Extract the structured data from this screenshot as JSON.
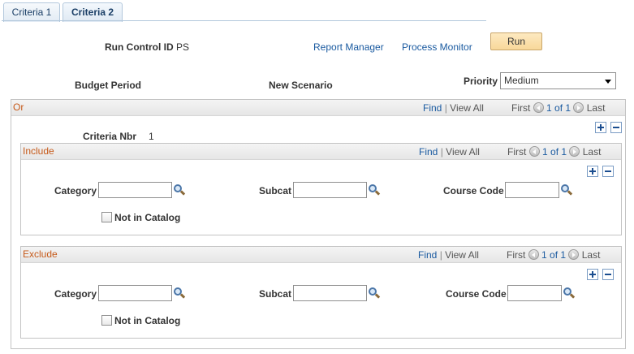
{
  "tabs": [
    {
      "label": "Criteria 1",
      "active": false
    },
    {
      "label": "Criteria 2",
      "active": true
    }
  ],
  "header": {
    "run_control_label": "Run Control ID",
    "run_control_value": "PS",
    "report_manager": "Report Manager",
    "process_monitor": "Process Monitor",
    "run_button": "Run"
  },
  "params": {
    "budget_period_label": "Budget Period",
    "new_scenario_label": "New Scenario",
    "priority_label": "Priority",
    "priority_value": "Medium"
  },
  "or_section": {
    "title": "Or",
    "find": "Find",
    "sep": "|",
    "view_all": "View All",
    "first": "First",
    "count": "1 of 1",
    "last": "Last",
    "criteria_nbr_label": "Criteria Nbr",
    "criteria_nbr_value": "1"
  },
  "include_section": {
    "title": "Include",
    "find": "Find",
    "sep": "|",
    "view_all": "View All",
    "first": "First",
    "count": "1 of 1",
    "last": "Last",
    "category_label": "Category",
    "subcat_label": "Subcat",
    "course_code_label": "Course Code",
    "not_in_catalog_label": "Not in Catalog",
    "category_value": "",
    "subcat_value": "",
    "course_code_value": ""
  },
  "exclude_section": {
    "title": "Exclude",
    "find": "Find",
    "sep": "|",
    "view_all": "View All",
    "first": "First",
    "count": "1 of 1",
    "last": "Last",
    "category_label": "Category",
    "subcat_label": "Subcat",
    "course_code_label": "Course Code",
    "not_in_catalog_label": "Not in Catalog",
    "category_value": "",
    "subcat_value": "",
    "course_code_value": ""
  },
  "colors": {
    "section_title": "#c65a1a",
    "link": "#1a5aa0",
    "run_button_bg": "#f8d89a"
  },
  "icons": [
    "lookup-icon",
    "first-arrow-icon",
    "last-arrow-icon",
    "add-row-icon",
    "delete-row-icon"
  ]
}
